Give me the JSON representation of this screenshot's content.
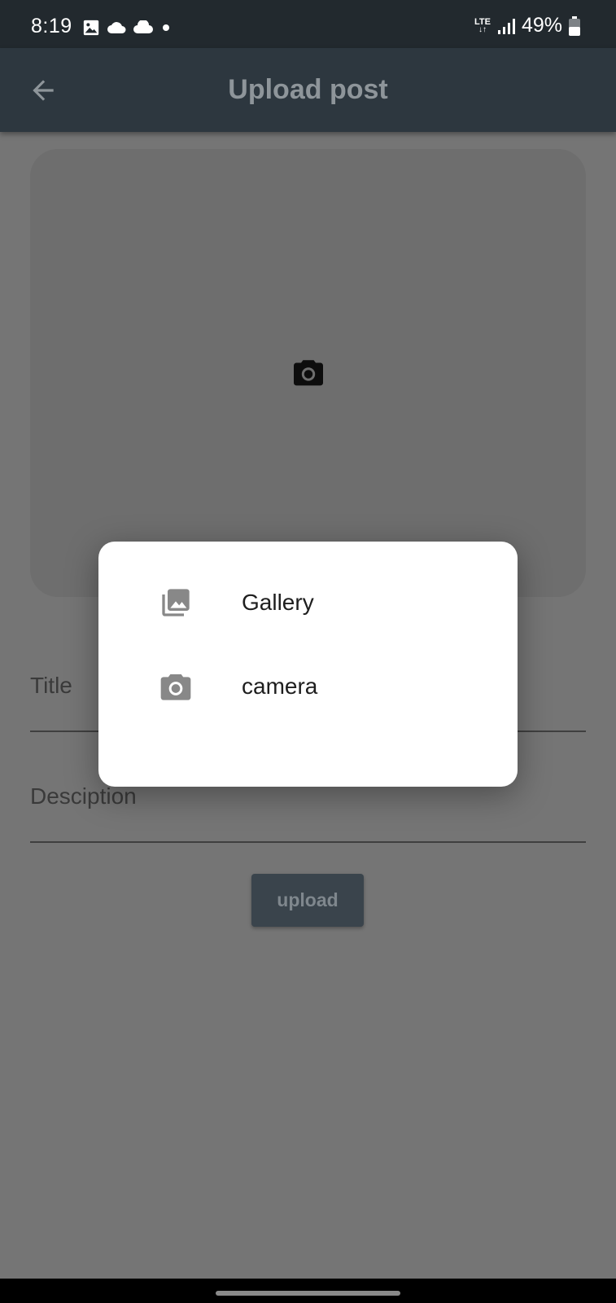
{
  "status_bar": {
    "time": "8:19",
    "network": "LTE",
    "battery": "49%"
  },
  "app_bar": {
    "title": "Upload post"
  },
  "form": {
    "title_label": "Title",
    "description_label": "Desciption",
    "upload_label": "upload"
  },
  "dialog": {
    "items": [
      {
        "label": "Gallery",
        "icon": "gallery-icon"
      },
      {
        "label": "camera",
        "icon": "camera-icon"
      }
    ]
  },
  "colors": {
    "scrim_background": "#757575",
    "app_bar": "#2d373f",
    "status_bar": "#22292e",
    "dialog": "#ffffff",
    "upload_button": "#3a444c"
  }
}
